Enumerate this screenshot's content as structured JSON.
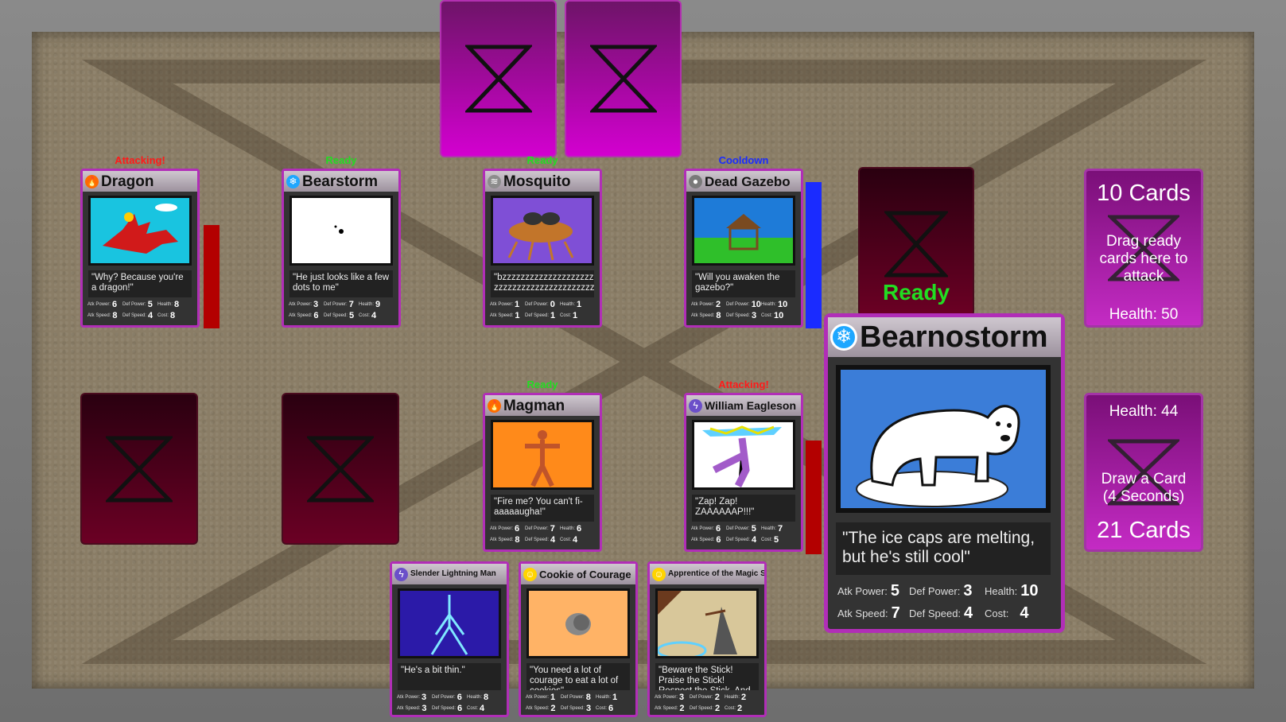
{
  "player_piles": {
    "enemy_deck": {
      "count_label": "10 Cards",
      "hint": "Drag ready cards here to attack",
      "health_label": "Health: 50"
    },
    "player_deck": {
      "health_label": "Health: 44",
      "hint": "Draw a Card (4 Seconds)",
      "count_label": "21 Cards"
    }
  },
  "ready_slot": {
    "status": "Ready"
  },
  "enemy_field": [
    {
      "name": "Dragon",
      "element": "fire",
      "status": "Attacking!",
      "quote": "\"Why? Because you're a dragon!\"",
      "atk_power": "6",
      "def_power": "5",
      "health": "8",
      "atk_speed": "8",
      "def_speed": "4",
      "cost": "8"
    },
    {
      "name": "Bearstorm",
      "element": "ice",
      "status": "Ready",
      "quote": "\"He just looks like a few dots to me\"",
      "atk_power": "3",
      "def_power": "7",
      "health": "9",
      "atk_speed": "6",
      "def_speed": "5",
      "cost": "4"
    },
    {
      "name": "Mosquito",
      "element": "air",
      "status": "Ready",
      "quote": "\"bzzzzzzzzzzzzzzzzzzzzzzzzzzz zzzzzzzzzzzzzzzzzzzzzzzzzz\"",
      "atk_power": "1",
      "def_power": "0",
      "health": "1",
      "atk_speed": "1",
      "def_speed": "1",
      "cost": "1"
    },
    {
      "name": "Dead Gazebo",
      "element": "earth",
      "status": "Cooldown",
      "quote": "\"Will you awaken the gazebo?\"",
      "atk_power": "2",
      "def_power": "10",
      "health": "10",
      "atk_speed": "8",
      "def_speed": "3",
      "cost": "10"
    }
  ],
  "player_field": [
    {
      "name": "Magman",
      "element": "fire",
      "status": "Ready",
      "quote": "\"Fire me? You can't fi-aaaaaugha!\"",
      "atk_power": "6",
      "def_power": "7",
      "health": "6",
      "atk_speed": "8",
      "def_speed": "4",
      "cost": "4"
    },
    {
      "name": "William Eagleson",
      "element": "lightning",
      "status": "Attacking!",
      "quote": "\"Zap! Zap! ZAAAAAAP!!!\"",
      "atk_power": "6",
      "def_power": "5",
      "health": "7",
      "atk_speed": "6",
      "def_speed": "4",
      "cost": "5"
    }
  ],
  "hand": [
    {
      "name": "Slender Lightning Man",
      "element": "lightning",
      "quote": "\"He's a bit thin.\"",
      "atk_power": "3",
      "def_power": "6",
      "health": "8",
      "atk_speed": "3",
      "def_speed": "6",
      "cost": "4"
    },
    {
      "name": "Cookie of Courage",
      "element": "light",
      "quote": "\"You need a lot of courage to eat a lot of cookies\"",
      "atk_power": "1",
      "def_power": "8",
      "health": "1",
      "atk_speed": "2",
      "def_speed": "3",
      "cost": "6"
    },
    {
      "name": "Apprentice of the Magic Stick",
      "element": "light",
      "quote": "\"Beware the Stick! Praise the Stick! Respect the Stick. And above all, stick the Stick... Somewhere safe.\"",
      "atk_power": "3",
      "def_power": "2",
      "health": "2",
      "atk_speed": "2",
      "def_speed": "2",
      "cost": "2"
    }
  ],
  "preview_card": {
    "name": "Bearnostorm",
    "element": "ice",
    "quote": "\"The ice caps are melting, but he's still cool\"",
    "atk_power": "5",
    "def_power": "3",
    "health": "10",
    "atk_speed": "7",
    "def_speed": "4",
    "cost": "4"
  },
  "stat_labels": {
    "atk_power": "Atk Power:",
    "def_power": "Def Power:",
    "health": "Health:",
    "atk_speed": "Atk Speed:",
    "def_speed": "Def Speed:",
    "cost": "Cost:"
  },
  "colors": {
    "attacking": "#ff1a1a",
    "ready": "#22dd22",
    "cooldown": "#1a2bff",
    "card_border": "#b12eb7",
    "fire": "#ff6a00",
    "ice": "#1ea7ff",
    "air": "#9a9a9a",
    "earth": "#8a8a8a",
    "lightning": "#6b4fc9",
    "light": "#ffd400"
  },
  "icons": {
    "fire": "flame-icon",
    "ice": "snowflake-icon",
    "air": "wind-icon",
    "earth": "rock-icon",
    "lightning": "lightning-icon",
    "light": "sun-icon",
    "deck": "hourglass-icon"
  }
}
